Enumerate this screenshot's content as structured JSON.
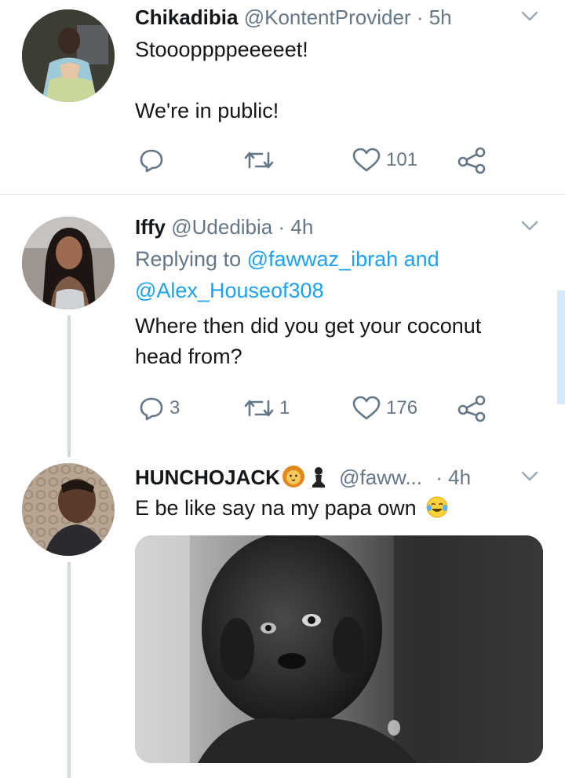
{
  "tweets": [
    {
      "name": "Chikadibia",
      "handle": "@KontentProvider",
      "sep": "·",
      "time": "5h",
      "text_lines": [
        "Stoooppppeeeeet!",
        "",
        "We're in public!"
      ],
      "replies": "",
      "retweets": "",
      "likes": "101"
    },
    {
      "name": "Iffy",
      "handle": "@Udedibia",
      "sep": "·",
      "time": "4h",
      "replying_prefix": "Replying to",
      "replying_to_1": "@fawwaz_ibrah",
      "replying_and": "and",
      "replying_to_2": "@Alex_Houseof308",
      "text_lines": [
        "Where then did you get your coconut",
        "head from?"
      ],
      "replies": "3",
      "retweets": "1",
      "likes": "176"
    },
    {
      "name": "HUNCHOJACK",
      "name_emoji_1": "lion-face",
      "name_emoji_2": "chess-pawn",
      "handle": "@faww...",
      "sep": "·",
      "time": "4h",
      "text": "E be like say na my papa own",
      "text_emoji": "face-with-tears-of-joy",
      "media": "black-and-white-photo-of-child"
    }
  ],
  "colors": {
    "text": "#14171a",
    "muted": "#657786",
    "link": "#1da1f2",
    "divider": "#e1e8ed",
    "thread": "#cfd9de"
  }
}
